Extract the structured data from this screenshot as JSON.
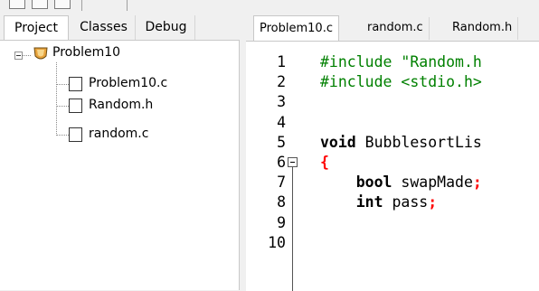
{
  "left_panel": {
    "tabs": [
      {
        "label": "Project",
        "active": true
      },
      {
        "label": "Classes",
        "active": false
      },
      {
        "label": "Debug",
        "active": false
      }
    ],
    "tree": {
      "project": {
        "label": "Problem10",
        "icon": "project-icon"
      },
      "files": [
        {
          "label": "Problem10.c",
          "icon": "file-icon"
        },
        {
          "label": "Random.h",
          "icon": "file-icon"
        },
        {
          "label": "random.c",
          "icon": "file-icon"
        }
      ]
    }
  },
  "editor": {
    "tabs": [
      {
        "label": "Problem10.c",
        "active": true
      },
      {
        "label": "random.c",
        "active": false
      },
      {
        "label": "Random.h",
        "active": false
      }
    ],
    "lines": [
      {
        "number": "1",
        "parts": [
          {
            "t": "#include \"Random.h",
            "c": "preproc"
          }
        ]
      },
      {
        "number": "2",
        "parts": [
          {
            "t": "#include <stdio.h>",
            "c": "preproc"
          }
        ]
      },
      {
        "number": "3",
        "parts": []
      },
      {
        "number": "4",
        "parts": []
      },
      {
        "number": "5",
        "parts": [
          {
            "t": "void",
            "c": "kw"
          },
          {
            "t": " BubblesortLis",
            "c": "plain"
          }
        ]
      },
      {
        "number": "6",
        "parts": [
          {
            "t": "{",
            "c": "op"
          }
        ],
        "fold": true
      },
      {
        "number": "7",
        "parts": [
          {
            "t": "    ",
            "c": "plain"
          },
          {
            "t": "bool",
            "c": "kw"
          },
          {
            "t": " swapMade",
            "c": "plain"
          },
          {
            "t": ";",
            "c": "op"
          }
        ]
      },
      {
        "number": "8",
        "parts": [
          {
            "t": "    ",
            "c": "plain"
          },
          {
            "t": "int",
            "c": "kw"
          },
          {
            "t": " pass",
            "c": "plain"
          },
          {
            "t": ";",
            "c": "op"
          }
        ]
      },
      {
        "number": "9",
        "parts": []
      },
      {
        "number": "10",
        "parts": []
      }
    ]
  },
  "colors": {
    "preproc": "#008000",
    "operator": "#ff0000",
    "keyword": "#000000"
  }
}
